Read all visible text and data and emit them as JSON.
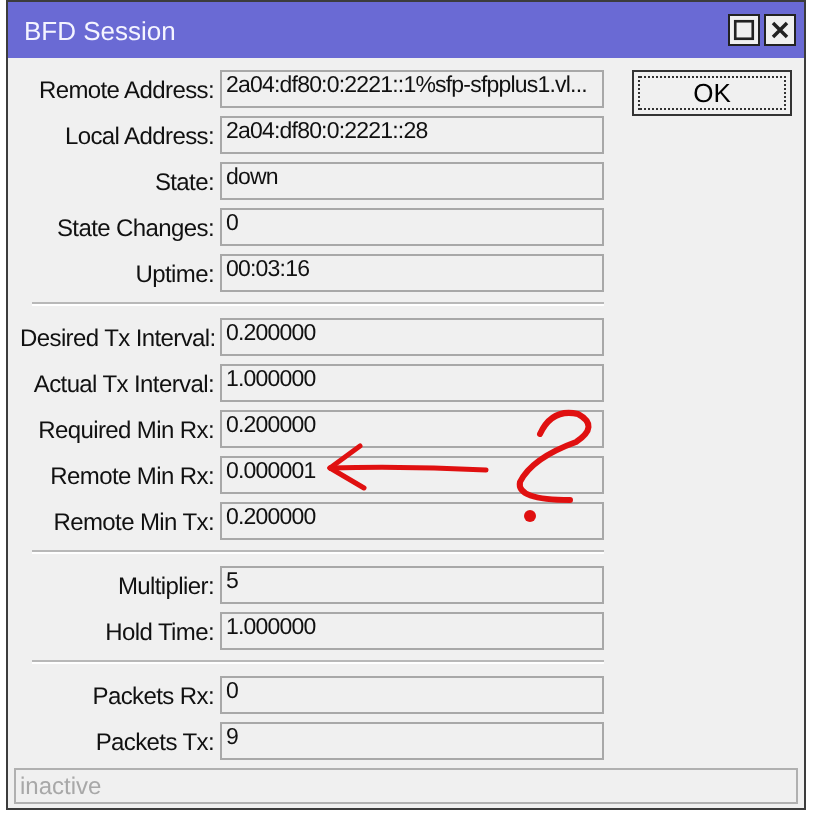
{
  "window": {
    "title": "BFD Session"
  },
  "groups": [
    {
      "fields": [
        {
          "label": "Remote Address:",
          "value": "2a04:df80:0:2221::1%sfp-sfpplus1.vl..."
        },
        {
          "label": "Local Address:",
          "value": "2a04:df80:0:2221::28"
        },
        {
          "label": "State:",
          "value": "down"
        },
        {
          "label": "State Changes:",
          "value": "0"
        },
        {
          "label": "Uptime:",
          "value": "00:03:16"
        }
      ]
    },
    {
      "fields": [
        {
          "label": "Desired Tx Interval:",
          "value": "0.200000"
        },
        {
          "label": "Actual Tx Interval:",
          "value": "1.000000"
        },
        {
          "label": "Required Min Rx:",
          "value": "0.200000"
        },
        {
          "label": "Remote Min Rx:",
          "value": "0.000001"
        },
        {
          "label": "Remote Min Tx:",
          "value": "0.200000"
        }
      ]
    },
    {
      "fields": [
        {
          "label": "Multiplier:",
          "value": "5"
        },
        {
          "label": "Hold Time:",
          "value": "1.000000"
        }
      ]
    },
    {
      "fields": [
        {
          "label": "Packets Rx:",
          "value": "0"
        },
        {
          "label": "Packets Tx:",
          "value": "9"
        }
      ]
    }
  ],
  "buttons": [
    "OK"
  ],
  "status_bar": "inactive"
}
